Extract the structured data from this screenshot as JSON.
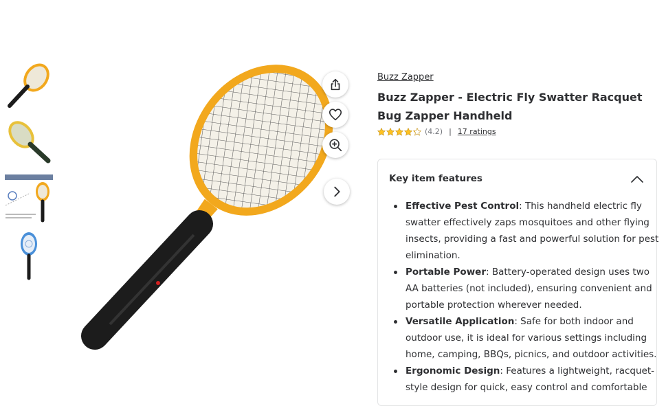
{
  "gallery": {
    "thumbnails": [
      {
        "alt": "racket-yellow-front"
      },
      {
        "alt": "racket-yellow-angled"
      },
      {
        "alt": "racket-instructions"
      },
      {
        "alt": "racket-blue"
      }
    ],
    "thumb3_caption": "Electric Fly Swatter Racquet Bug Zapper",
    "main_image_alt": "Electric fly swatter racket with yellow frame and black handle"
  },
  "actions": {
    "share_icon": "share-icon",
    "favorite_icon": "heart-icon",
    "zoom_icon": "zoom-in-icon",
    "next_icon": "chevron-right-icon"
  },
  "product": {
    "brand": "Buzz Zapper",
    "title": "Buzz Zapper - Electric Fly Swatter Racquet Bug Zapper Handheld",
    "rating": 4.2,
    "rating_text": "(4.2)",
    "separator": "|",
    "ratings_count": "17 ratings"
  },
  "features": {
    "title": "Key item features",
    "items": [
      {
        "name": "Effective Pest Control",
        "text": ": This handheld electric fly swatter effectively zaps mosquitoes and other flying insects, providing a fast and powerful solution for pest elimination."
      },
      {
        "name": "Portable Power",
        "text": ": Battery-operated design uses two AA batteries (not included), ensuring convenient and portable protection wherever needed."
      },
      {
        "name": "Versatile Application",
        "text": ": Safe for both indoor and outdoor use, it is ideal for various settings including home, camping, BBQs, picnics, and outdoor activities."
      },
      {
        "name": "Ergonomic Design",
        "text": ": Features a lightweight, racquet-style design for quick, easy control and comfortable"
      }
    ]
  },
  "colors": {
    "racket_frame": "#f2a81d",
    "racket_handle": "#1c1c1c",
    "star_fill": "#ffc220",
    "blue_frame": "#4a90d9"
  }
}
